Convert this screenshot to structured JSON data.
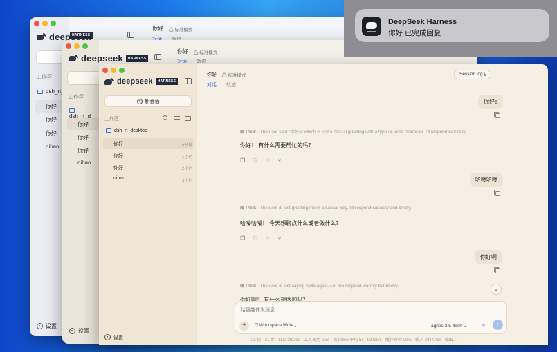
{
  "notification": {
    "title": "DeepSeek Harness",
    "body": "你好 已完成回复"
  },
  "brand": {
    "wordmark": "deepseek",
    "badge": "HARNESS"
  },
  "win1": {
    "header_title": "你好",
    "mode": "标准模式",
    "tab_chat": "对话",
    "tab_trace": "轨迹",
    "workspace_label": "工作区",
    "folder": "dsh_rt_",
    "items": [
      "你好",
      "你好",
      "你好",
      "nihao"
    ],
    "settings": "设置"
  },
  "win2": {
    "header_title": "你好",
    "mode": "标准模式",
    "tab_chat": "对话",
    "tab_trace": "轨迹",
    "workspace_label": "工作区",
    "folder": "dsh_rt_d",
    "items": [
      "你好",
      "你好",
      "你好",
      "nihao"
    ],
    "settings": "设置"
  },
  "sidebar": {
    "new_chat": "新会话",
    "workspace_label": "工作区",
    "folder": "dsh_rt_desktop",
    "items": [
      {
        "title": "你好",
        "time": "6分钟"
      },
      {
        "title": "你好",
        "time": "1小时"
      },
      {
        "title": "你好",
        "time": "2小时"
      },
      {
        "title": "nihao",
        "time": "3小时"
      }
    ],
    "settings": "设置"
  },
  "header": {
    "title": "你好",
    "mode": "标准模式",
    "session_log": "Session log",
    "tab_chat": "对话",
    "tab_trace": "轨迹"
  },
  "messages": [
    {
      "user": "你好a",
      "think_label": "Think",
      "think": "The user said \"你好a\" which is just a casual greeting with a typo or extra character. I'll respond naturally.",
      "reply": "你好！ 有什么需要帮忙的吗？"
    },
    {
      "user": "哈喽哈喽",
      "think_label": "Think",
      "think": "The user is just greeting me in a casual way. I'll respond casually and briefly.",
      "reply": "哈喽哈喽！ 今天想聊点什么或者做什么？"
    },
    {
      "user": "你好啊",
      "think_label": "Think",
      "think": "The user is just saying hello again. Let me respond warmly but briefly.",
      "reply": "你好啊！ 有什么想做的吗？"
    }
  ],
  "composer": {
    "placeholder": "给智能体发消息",
    "workspace": "Workspace Write",
    "model": "agnes-2.5-flash"
  },
  "footer": "23 轮 · 31 步 · LLM 3m29s · 工具调用 0.3s · 首 token 平均 5s · 93 tok/s · 缓存命中 20% · 输入 434K tok · 输出..."
}
